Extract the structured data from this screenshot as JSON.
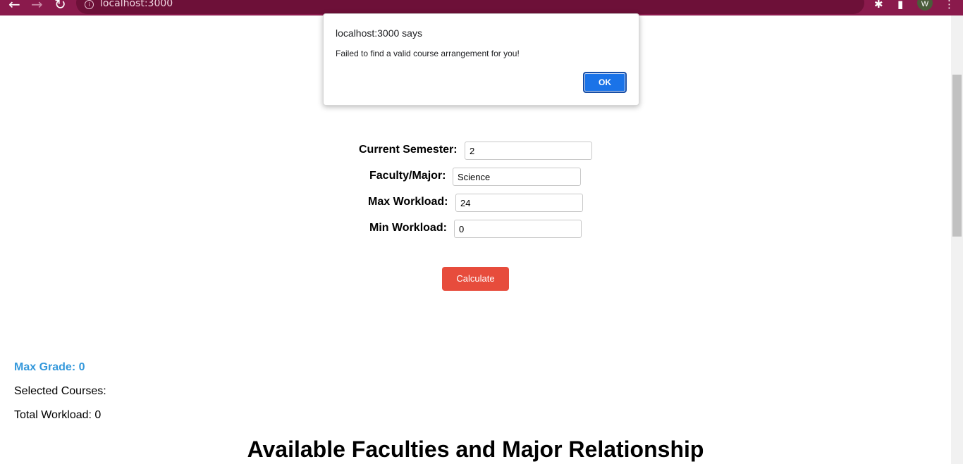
{
  "browser": {
    "back_glyph": "←",
    "forward_glyph": "→",
    "reload_glyph": "↻",
    "info_glyph": "i",
    "url": "localhost:3000",
    "install_glyph": "⬇",
    "share_glyph": "⇪",
    "star_glyph": "☆",
    "extensions_glyph": "✱",
    "sidepanel_glyph": "▮",
    "avatar_initial": "W",
    "menu_glyph": "⋮",
    "accent_color": "#8a1a4c"
  },
  "dialog": {
    "title": "localhost:3000 says",
    "message": "Failed to find a valid course arrangement for you!",
    "ok_label": "OK"
  },
  "form": {
    "current_semester": {
      "label": "Current Semester:",
      "value": "2"
    },
    "faculty_major": {
      "label": "Faculty/Major:",
      "value": "Science"
    },
    "max_workload": {
      "label": "Max Workload:",
      "value": "24"
    },
    "min_workload": {
      "label": "Min Workload:",
      "value": "0"
    },
    "calculate_label": "Calculate"
  },
  "results": {
    "max_grade": "Max Grade: 0",
    "selected_courses": "Selected Courses:",
    "total_workload": "Total Workload: 0"
  },
  "section": {
    "heading": "Available Faculties and Major Relationship"
  }
}
